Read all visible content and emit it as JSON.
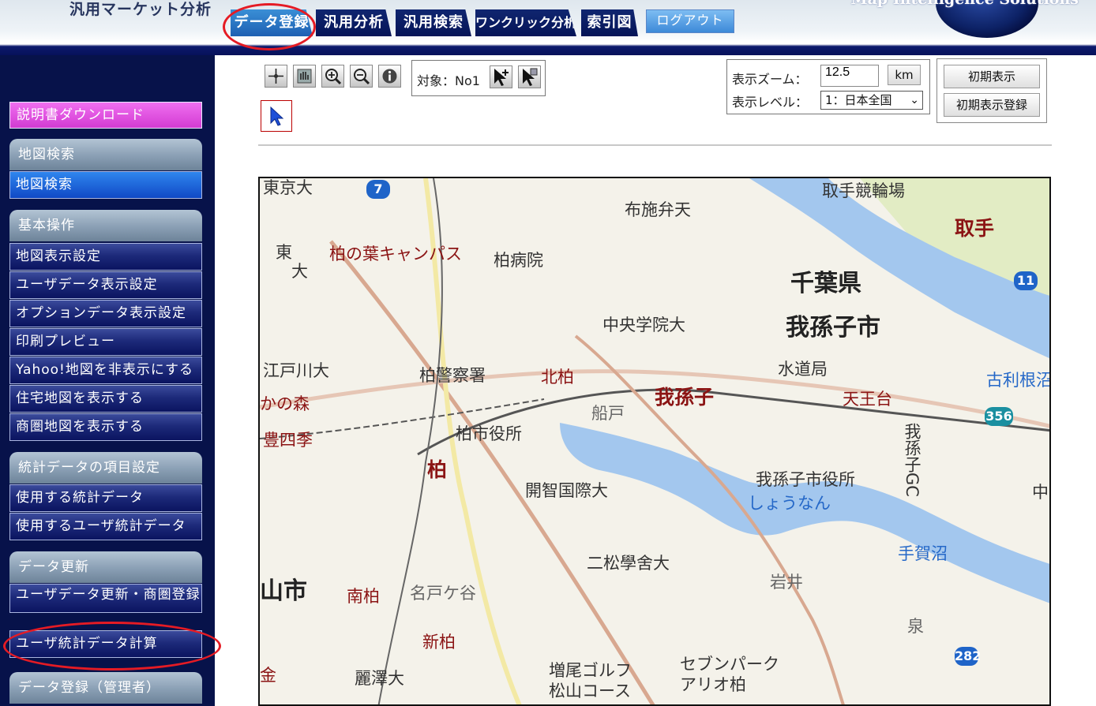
{
  "header": {
    "app_title": "汎用マーケット分析",
    "brand_text": "Map Intelligence Solutions",
    "tabs": [
      "データ登録",
      "汎用分析",
      "汎用検索",
      "ワンクリック分析",
      "索引図"
    ],
    "logout_label": "ログアウト"
  },
  "sidebar": {
    "download_label": "説明書ダウンロード",
    "sections": [
      {
        "title": "地図検索",
        "items": [
          "地図検索"
        ]
      },
      {
        "title": "基本操作",
        "items": [
          "地図表示設定",
          "ユーザデータ表示設定",
          "オプションデータ表示設定",
          "印刷プレビュー",
          "Yahoo!地図を非表示にする",
          "住宅地図を表示する",
          "商圏地図を表示する"
        ]
      },
      {
        "title": "統計データの項目設定",
        "items": [
          "使用する統計データ",
          "使用するユーザ統計データ"
        ]
      },
      {
        "title": "データ更新",
        "items": [
          "ユーザデータ更新・商圏登録",
          "ユーザ統計データ計算"
        ]
      },
      {
        "title": "データ登録（管理者）",
        "items": []
      }
    ]
  },
  "toolbar": {
    "target_label": "対象：No1",
    "zoom_label": "表示ズーム：",
    "zoom_value": "12.5",
    "km_label": "km",
    "level_label": "表示レベル：",
    "level_value": "1：日本全国",
    "reset_label": "初期表示",
    "reset_register_label": "初期表示登録",
    "tool_icons": [
      "pan-crosshair-icon",
      "hand-move-icon",
      "zoom-in-icon",
      "zoom-out-icon",
      "info-icon",
      "add-target-icon",
      "move-target-icon",
      "pointer-icon"
    ]
  },
  "map": {
    "labels": {
      "tokyodai": "東京大",
      "toride_keirin": "取手競輪場",
      "fuse_benten": "布施弁天",
      "toride_st": "取手",
      "touhigashi": "東",
      "dai": "大",
      "kashiwanoha": "柏の葉キャンパス",
      "kashiwa_hosp": "柏病院",
      "chiba_pref": "千葉県",
      "chuo_gakuin": "中央学院大",
      "abiko_city": "我孫子市",
      "edogawa": "江戸川大",
      "police": "柏警察署",
      "kitakashiwa": "北柏",
      "suidokyoku": "水道局",
      "tennodai": "天王台",
      "tone": "古利根沼",
      "kanomori": "かの森",
      "funado": "船戸",
      "abiko_st": "我孫子",
      "toyoshiki": "豊四季",
      "city_office": "柏市役所",
      "abiko_gc": "我孫子GC",
      "kashiwa_st": "柏",
      "kaichi": "開智国際大",
      "abiko_office": "我孫子市役所",
      "shonan": "しょうなん",
      "naka": "中",
      "teganuma": "手賀沼",
      "nishomatsu": "二松學舍大",
      "minamikashiwa": "南柏",
      "nadogaya": "名戸ケ谷",
      "iwai": "岩井",
      "yamashi": "山市",
      "izumi": "泉",
      "shinkashiwa": "新柏",
      "seven_park": "セブンパーク",
      "ario": "アリオ柏",
      "masuo_golf": "増尾ゴルフ",
      "matsuyama": "松山コース",
      "reitaku": "麗澤大",
      "kin": "金"
    },
    "routes": [
      "7",
      "11",
      "356",
      "282"
    ]
  },
  "colors": {
    "accent_tab": "#2a78c8",
    "sidebar_bg": "#07124a",
    "highlight_oval": "#e51b24",
    "water": "#a3c7ee",
    "station_red": "#8b1414"
  }
}
